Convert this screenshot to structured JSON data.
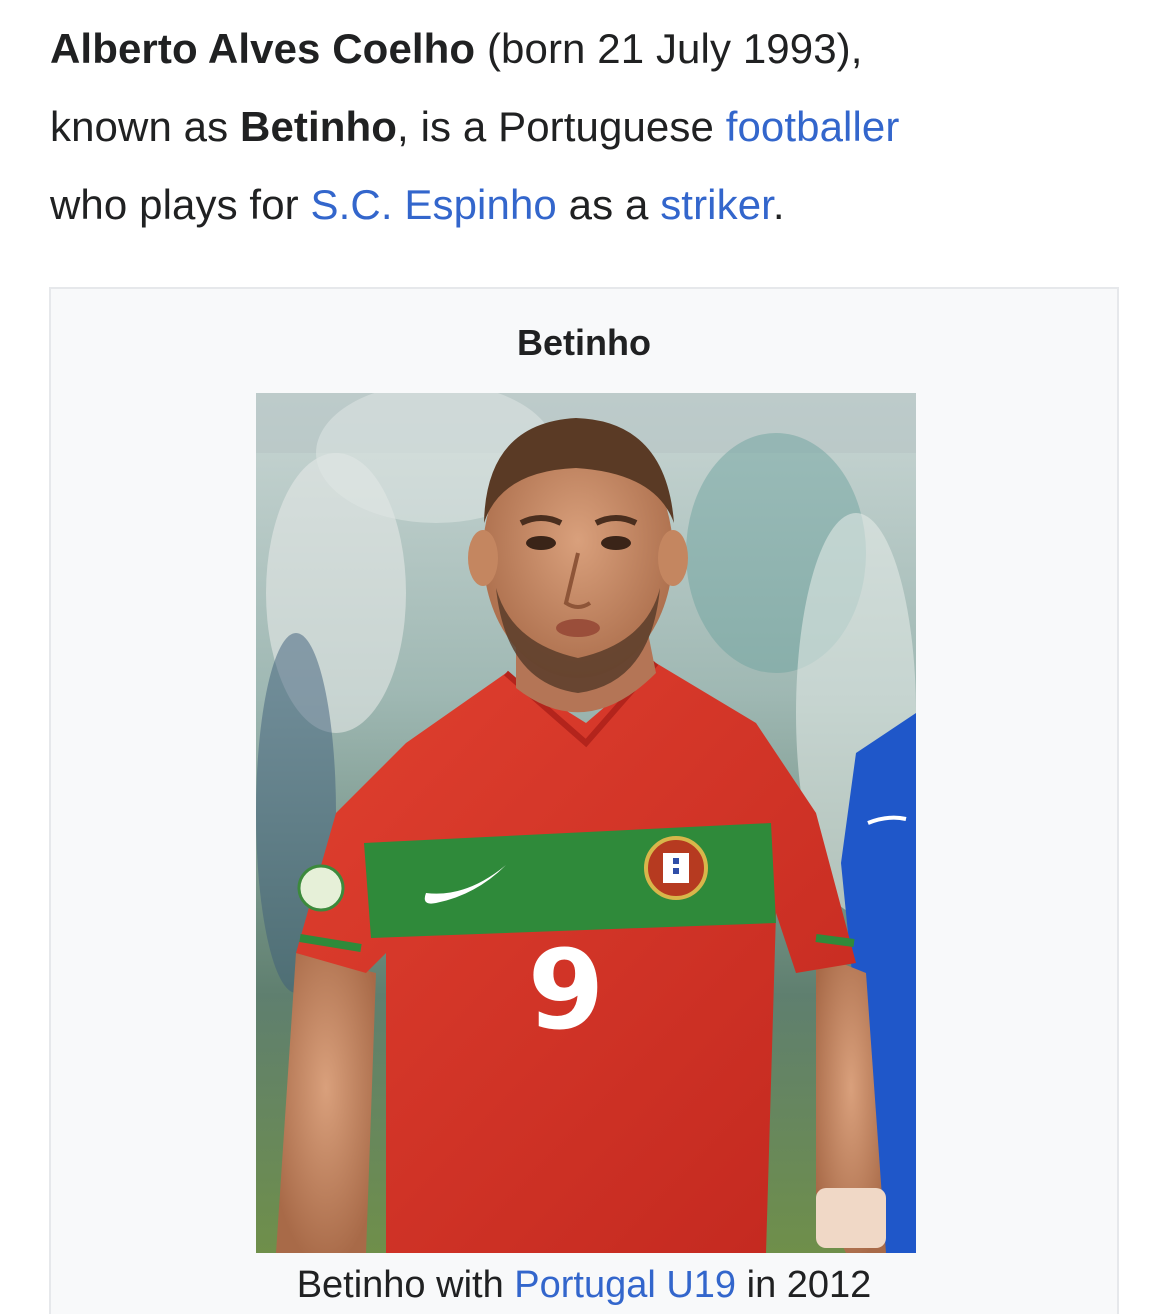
{
  "article": {
    "full_name": "Alberto Alves Coelho",
    "born_text": " (born 21 July 1993),",
    "known_as_prefix": "known as ",
    "nickname": "Betinho",
    "nationality_text": ", is a Portuguese ",
    "link_footballer": "footballer",
    "plays_for_text": " who plays for ",
    "link_club": "S.C. Espinho",
    "as_a_text": " as a ",
    "link_position": "striker",
    "period": "."
  },
  "infobox": {
    "title": "Betinho",
    "shirt_number": "9",
    "caption_prefix": "Betinho with ",
    "caption_link": "Portugal U19",
    "caption_suffix": " in 2012"
  },
  "colors": {
    "link": "#3366cc",
    "text": "#202122",
    "infobox_bg": "#f8f9fa",
    "jersey_red": "#d8312a",
    "jersey_green": "#2f8a3a",
    "opponent_blue": "#1f57c9"
  },
  "icons": {
    "crest": "portugal-crest-icon",
    "swoosh": "nike-swoosh-icon"
  }
}
